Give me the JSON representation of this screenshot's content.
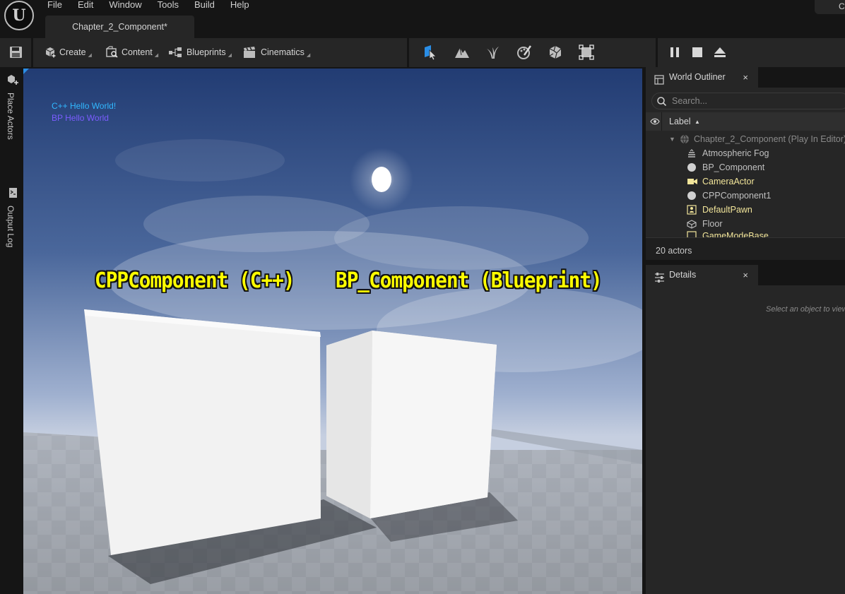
{
  "menu": [
    "File",
    "Edit",
    "Window",
    "Tools",
    "Build",
    "Help"
  ],
  "document_tab": "Chapter_2_Component*",
  "user_corner": "C",
  "toolbar": {
    "create": "Create",
    "content": "Content",
    "blueprints": "Blueprints",
    "cinematics": "Cinematics"
  },
  "left_tabs": {
    "place_actors": "Place Actors",
    "output_log": "Output Log"
  },
  "viewport": {
    "debug_messages": [
      {
        "text": "C++ Hello World!",
        "color": "#31b8ff"
      },
      {
        "text": "BP Hello World",
        "color": "#7b5cff"
      }
    ],
    "labels": {
      "cpp": "CPPComponent (C++)",
      "bp": "BP_Component (Blueprint)"
    },
    "label_color": "#ffff00"
  },
  "world_outliner": {
    "title": "World Outliner",
    "close": "×",
    "search_placeholder": "Search...",
    "column_label": "Label",
    "root": "Chapter_2_Component (Play In Editor)",
    "items": [
      {
        "label": "Atmospheric Fog",
        "color": "#c8c8c8",
        "icon": "fog-icon"
      },
      {
        "label": "BP_Component",
        "color": "#c8c8c8",
        "icon": "sphere-icon"
      },
      {
        "label": "CameraActor",
        "color": "#f2e59a",
        "icon": "camera-icon"
      },
      {
        "label": "CPPComponent1",
        "color": "#c8c8c8",
        "icon": "sphere-icon"
      },
      {
        "label": "DefaultPawn",
        "color": "#f2e59a",
        "icon": "pawn-icon"
      },
      {
        "label": "Floor",
        "color": "#c8c8c8",
        "icon": "mesh-icon"
      },
      {
        "label": "GameModeBase",
        "color": "#f2e59a",
        "icon": "gamemode-icon"
      }
    ],
    "actor_count": "20 actors"
  },
  "details": {
    "title": "Details",
    "close": "×",
    "hint": "Select an object to view details."
  }
}
